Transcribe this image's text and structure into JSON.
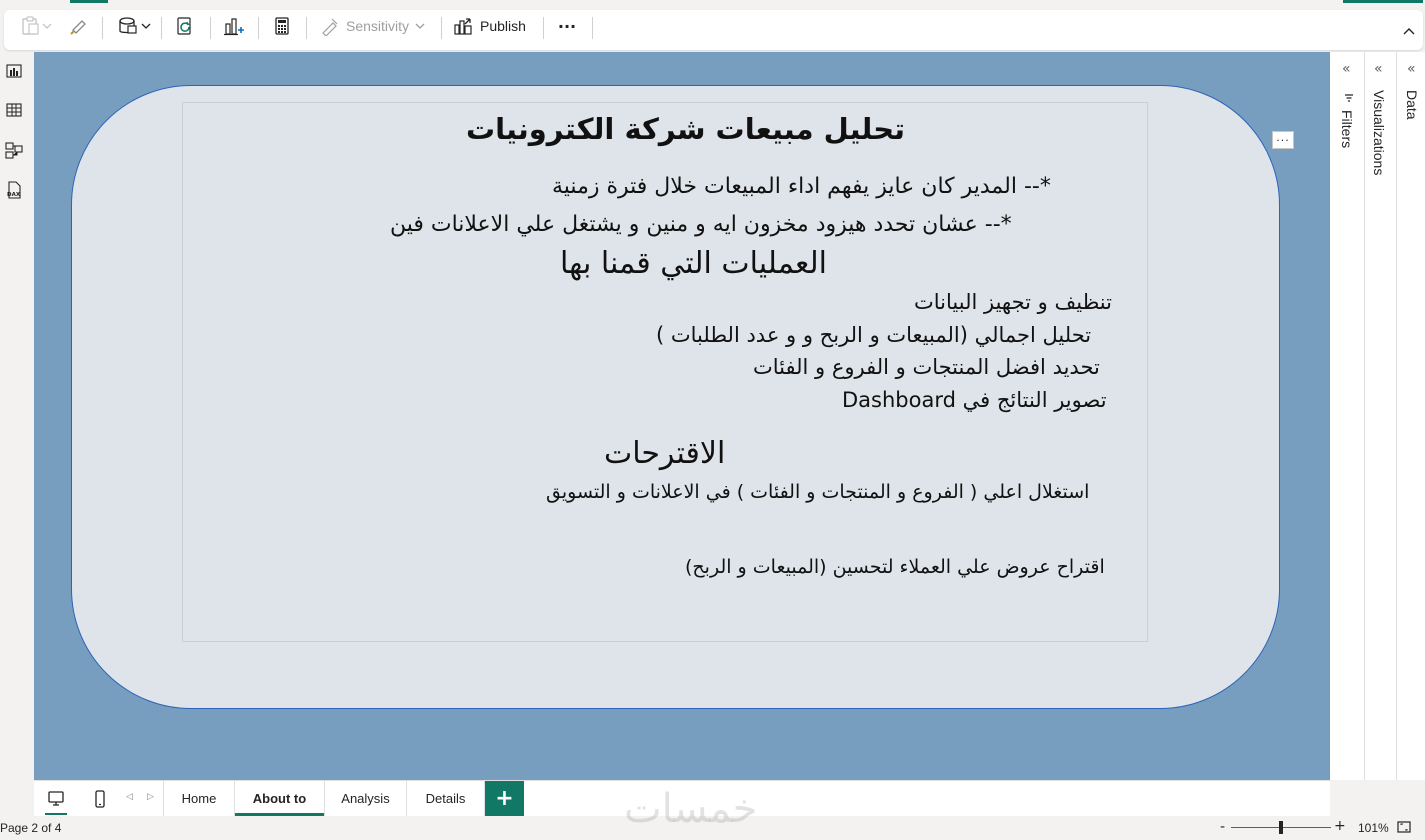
{
  "ribbon": {
    "sensitivity_label": "Sensitivity",
    "publish_label": "Publish",
    "more_label": "···"
  },
  "canvas": {
    "more_options": "···",
    "title": "تحليل مبيعات شركة الكترونيات",
    "lines": [
      "*--  المدير كان عايز يفهم اداء المبيعات خلال فترة زمنية",
      "*--   عشان تحدد هيزود مخزون ايه و منين و يشتغل علي الاعلانات فين"
    ],
    "operations_heading": "العمليات التي قمنا بها",
    "operations": [
      "تنظيف و تجهيز البيانات",
      "تحليل اجمالي (المبيعات و الربح و و عدد الطلبات )",
      "تحديد افضل المنتجات و الفروع و الفئات",
      "تصوير النتائج في Dashboard"
    ],
    "suggestions_heading": "الاقترحات",
    "suggestions": [
      "استغلال اعلي ( الفروع و المنتجات و الفئات ) في الاعلانات و التسويق",
      "اقتراح عروض علي العملاء لتحسين (المبيعات و الربح)"
    ]
  },
  "panes": {
    "filters": "Filters",
    "visualizations": "Visualizations",
    "data": "Data",
    "collapse": "«"
  },
  "tabs": [
    {
      "label": "Home"
    },
    {
      "label": "About to"
    },
    {
      "label": "Analysis"
    },
    {
      "label": "Details"
    }
  ],
  "add_page": "+",
  "status": {
    "page_indicator": "Page 2 of 4",
    "zoom": "101%",
    "zoom_level": 0.5,
    "watermark": "خمسات"
  },
  "colors": {
    "accent": "#117865",
    "canvas_background": "#789ebf",
    "shape_fill": "#dee4e9",
    "shape_border": "#2d64b8"
  }
}
